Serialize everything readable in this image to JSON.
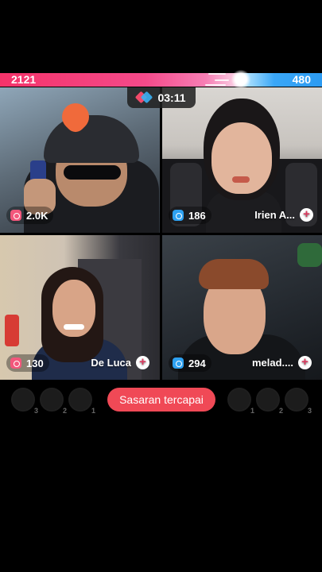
{
  "scores": {
    "left": "2121",
    "right": "480"
  },
  "timer": {
    "value": "03:11",
    "icon": "battle-icon"
  },
  "tiles": [
    {
      "stat": "2.0K",
      "stat_icon": "coin-icon",
      "name": ""
    },
    {
      "stat": "186",
      "stat_icon": "coin-icon",
      "name": "Irien A..."
    },
    {
      "stat": "130",
      "stat_icon": "coin-icon",
      "name": "De Luca"
    },
    {
      "stat": "294",
      "stat_icon": "coin-icon",
      "name": "melad...."
    }
  ],
  "bottom": {
    "target_label": "Sasaran tercapai",
    "left_avatars": [
      {
        "rank": "3"
      },
      {
        "rank": "2"
      },
      {
        "rank": "1"
      }
    ],
    "right_avatars": [
      {
        "rank": "1"
      },
      {
        "rank": "2"
      },
      {
        "rank": "3"
      }
    ]
  },
  "colors": {
    "team_red": "#f5336a",
    "team_blue": "#2c9bf2",
    "target_button": "#f04956"
  }
}
